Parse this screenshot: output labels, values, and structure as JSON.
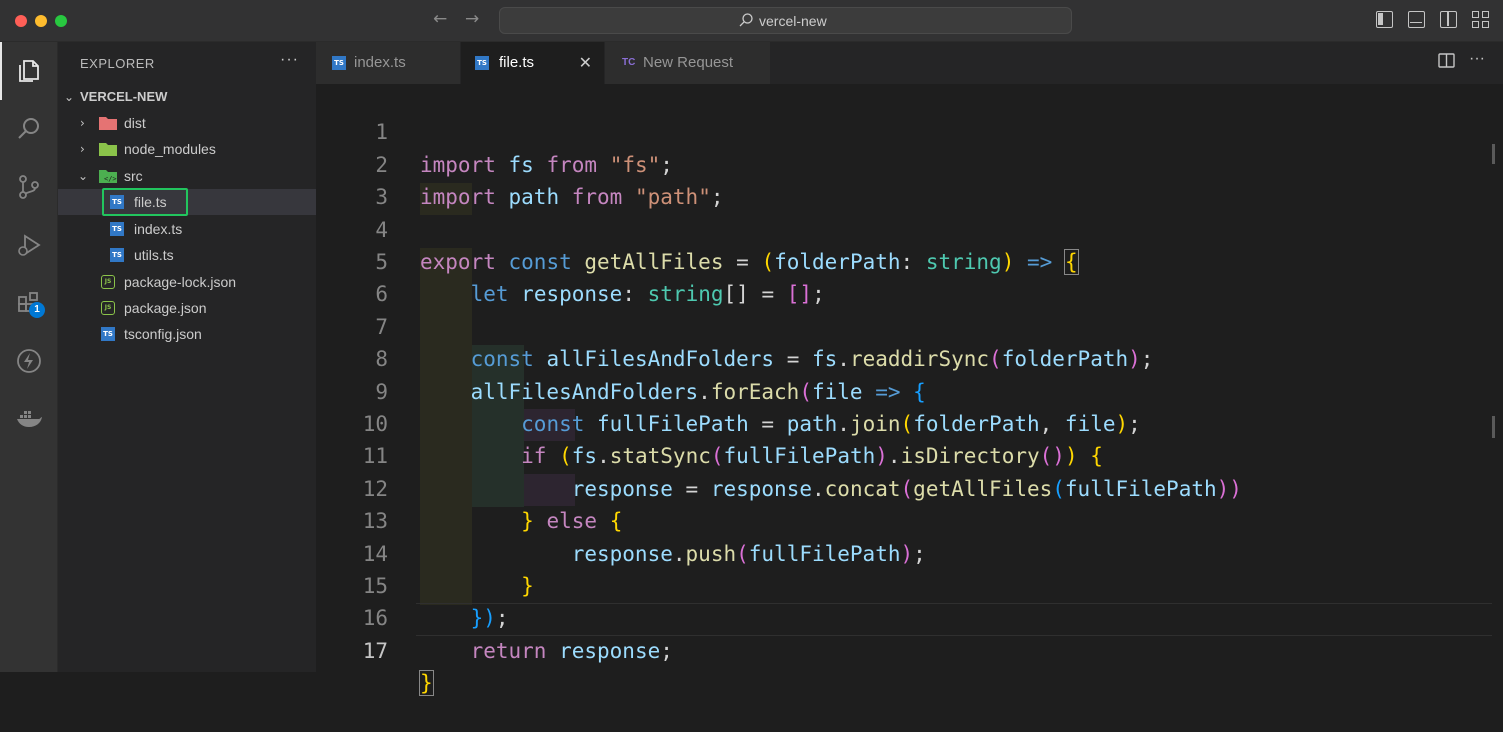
{
  "window": {
    "title": "vercel-new"
  },
  "activity_bar": {
    "items": [
      {
        "name": "explorer",
        "icon": "files-icon",
        "active": true
      },
      {
        "name": "search",
        "icon": "search-icon"
      },
      {
        "name": "source-control",
        "icon": "source-control-icon"
      },
      {
        "name": "run-debug",
        "icon": "run-debug-icon"
      },
      {
        "name": "extensions",
        "icon": "extensions-icon",
        "badge": "1"
      },
      {
        "name": "thunder-client",
        "icon": "lightning-icon"
      },
      {
        "name": "docker",
        "icon": "docker-icon"
      }
    ]
  },
  "explorer": {
    "header": "EXPLORER",
    "root": "VERCEL-NEW",
    "items": [
      {
        "label": "dist",
        "type": "folder",
        "expanded": false
      },
      {
        "label": "node_modules",
        "type": "folder",
        "expanded": false
      },
      {
        "label": "src",
        "type": "folder",
        "expanded": true
      },
      {
        "label": "file.ts",
        "type": "ts",
        "selected": true
      },
      {
        "label": "index.ts",
        "type": "ts"
      },
      {
        "label": "utils.ts",
        "type": "ts"
      },
      {
        "label": "package-lock.json",
        "type": "json"
      },
      {
        "label": "package.json",
        "type": "json"
      },
      {
        "label": "tsconfig.json",
        "type": "tsconfig"
      }
    ]
  },
  "tabs": [
    {
      "label": "index.ts",
      "icon": "ts",
      "active": false
    },
    {
      "label": "file.ts",
      "icon": "ts",
      "active": true,
      "close": "✕"
    },
    {
      "label": "New Request",
      "icon": "TC",
      "active": false
    }
  ],
  "editor": {
    "current_line": 17,
    "lines": [
      {
        "n": "1"
      },
      {
        "n": "2"
      },
      {
        "n": "3"
      },
      {
        "n": "4"
      },
      {
        "n": "5"
      },
      {
        "n": "6"
      },
      {
        "n": "7"
      },
      {
        "n": "8"
      },
      {
        "n": "9"
      },
      {
        "n": "10"
      },
      {
        "n": "11"
      },
      {
        "n": "12"
      },
      {
        "n": "13"
      },
      {
        "n": "14"
      },
      {
        "n": "15"
      },
      {
        "n": "16"
      },
      {
        "n": "17"
      }
    ],
    "tokens": {
      "l1": [
        "import",
        "fs",
        "from",
        "\"fs\"",
        ";"
      ],
      "l2": [
        "import",
        "path",
        "from",
        "\"path\"",
        ";"
      ],
      "l4": [
        "export",
        "const",
        "getAllFiles",
        "=",
        "(",
        "folderPath",
        ":",
        "string",
        ")",
        "=>",
        "{"
      ],
      "l5": [
        "let",
        "response",
        ":",
        "string",
        "[]",
        "=",
        "[]",
        ";"
      ],
      "l7": [
        "const",
        "allFilesAndFolders",
        "=",
        "fs",
        ".",
        "readdirSync",
        "(",
        "folderPath",
        ")",
        ";"
      ],
      "l8": [
        "allFilesAndFolders",
        ".",
        "forEach",
        "(",
        "file",
        "=>",
        "{"
      ],
      "l9": [
        "const",
        "fullFilePath",
        "=",
        "path",
        ".",
        "join",
        "(",
        "folderPath",
        ", ",
        "file",
        ")",
        ";"
      ],
      "l10": [
        "if",
        "(",
        "fs",
        ".",
        "statSync",
        "(",
        "fullFilePath",
        ")",
        ".",
        "isDirectory",
        "()",
        ")",
        "{"
      ],
      "l11": [
        "response",
        "=",
        "response",
        ".",
        "concat",
        "(",
        "getAllFiles",
        "(",
        "fullFilePath",
        "))"
      ],
      "l12": [
        "}",
        "else",
        "{"
      ],
      "l13": [
        "response",
        ".",
        "push",
        "(",
        "fullFilePath",
        ")",
        ";"
      ],
      "l14": [
        "}"
      ],
      "l15": [
        "})",
        ";"
      ],
      "l16": [
        "return",
        "response",
        ";"
      ],
      "l17": [
        "}"
      ]
    }
  },
  "colors": {
    "accent": "#0078d4",
    "highlight_box": "#22c55e",
    "keyword": "#c586c0",
    "storage": "#569cd6",
    "string": "#ce9178",
    "variable": "#9cdcfe",
    "function": "#dcdcaa",
    "type": "#4ec9b0"
  }
}
